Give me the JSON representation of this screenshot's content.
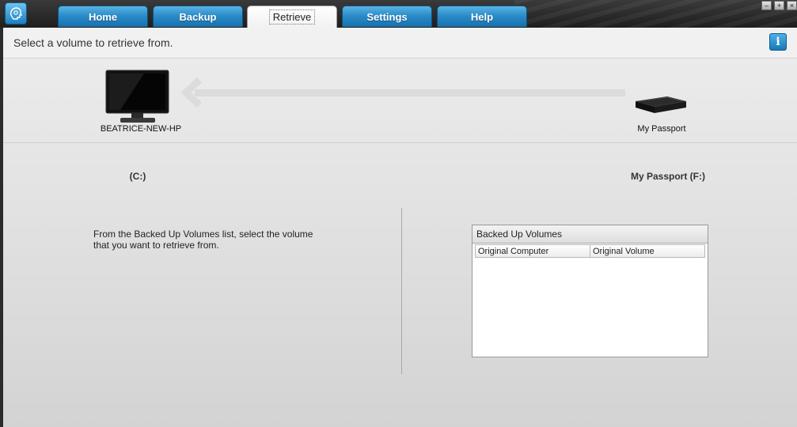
{
  "tabs": [
    {
      "label": "Home"
    },
    {
      "label": "Backup"
    },
    {
      "label": "Retrieve"
    },
    {
      "label": "Settings"
    },
    {
      "label": "Help"
    }
  ],
  "active_tab": "Retrieve",
  "header": {
    "title": "Select a volume to retrieve from."
  },
  "devices": {
    "computer": {
      "name": "BEATRICE-NEW-HP",
      "volume": "(C:)"
    },
    "drive": {
      "name": "My Passport",
      "volume": "My Passport (F:)"
    }
  },
  "instructions": "From the Backed Up Volumes list, select the volume that you want to retrieve from.",
  "volumes_list": {
    "title": "Backed Up Volumes",
    "columns": [
      "Original Computer",
      "Original Volume"
    ],
    "rows": []
  },
  "icons": {
    "app": "wd-smartware-logo-icon",
    "info": "info-icon",
    "computer": "monitor-icon",
    "drive": "external-drive-icon",
    "arrow": "arrow-left-icon"
  },
  "colors": {
    "tab_blue": "#2b8cc9",
    "info_blue": "#1678b8"
  },
  "window_controls": {
    "minimize": "–",
    "maximize": "+",
    "close": "×"
  }
}
